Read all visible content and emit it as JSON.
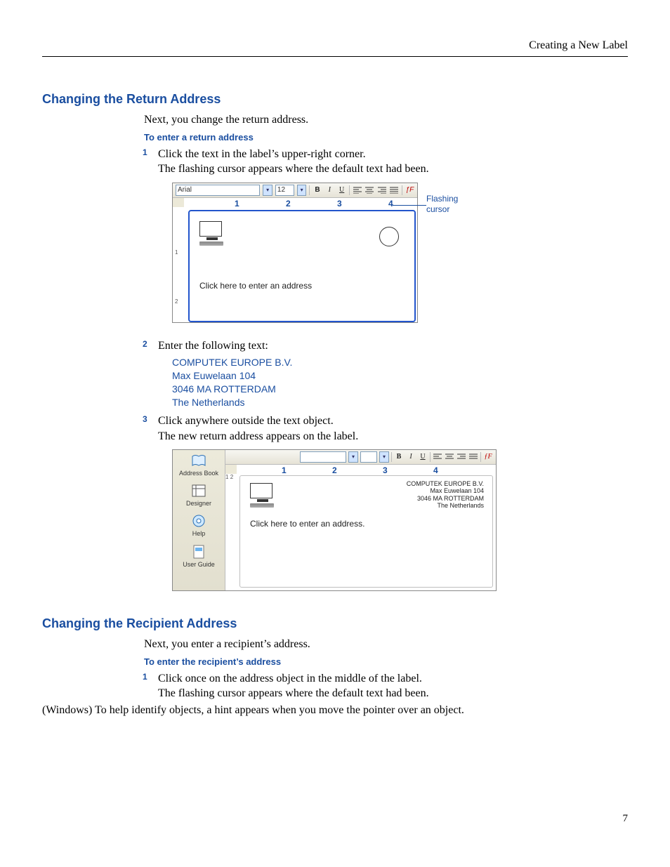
{
  "header": {
    "chapter": "Creating a New Label"
  },
  "page_number": "7",
  "section1": {
    "heading": "Changing the Return Address",
    "intro": "Next, you change the return address.",
    "subhead": "To enter a return address",
    "step1a": "Click the text in the label’s upper-right corner.",
    "step1b": "The flashing cursor appears where the default text had been.",
    "step2": "Enter the following text:",
    "addr": {
      "l1": "COMPUTEK EUROPE B.V.",
      "l2": "Max Euwelaan 104",
      "l3": "3046 MA  ROTTERDAM",
      "l4": "The Netherlands"
    },
    "step3a": "Click anywhere outside the text object.",
    "step3b": "The new return address appears on the label."
  },
  "shot1": {
    "font_family": "Arial",
    "font_size": "12",
    "ruler_h": [
      "1",
      "2",
      "3",
      "4"
    ],
    "ruler_v": [
      "1",
      "2"
    ],
    "placeholder": "Click here to enter an address",
    "callout_l1": "Flashing",
    "callout_l2": "cursor",
    "btn_bold": "B",
    "btn_italic": "I",
    "btn_underline": "U",
    "btn_fx": "ƒF"
  },
  "shot2": {
    "sidebar": {
      "address_book": "Address Book",
      "designer": "Designer",
      "help": "Help",
      "user_guide": "User Guide"
    },
    "ruler_h": [
      "1",
      "2",
      "3",
      "4"
    ],
    "ruler_v": [
      "1",
      "2"
    ],
    "ret": {
      "l1": "COMPUTEK EUROPE B.V.",
      "l2": "Max Euwelaan 104",
      "l3": "3046 MA  ROTTERDAM",
      "l4": "The Netherlands"
    },
    "placeholder": "Click here to enter an address.",
    "btn_bold": "B",
    "btn_italic": "I",
    "btn_underline": "U",
    "btn_fx": "ƒF"
  },
  "section2": {
    "heading": "Changing the Recipient Address",
    "intro": "Next, you enter a recipient’s address.",
    "subhead": "To enter the recipient’s address",
    "step1a": "Click once on the address object in the middle of the label.",
    "step1b": "The flashing cursor appears where the default text had been.",
    "step1c": "(Windows) To help identify objects, a hint appears when you move the pointer over an object."
  }
}
